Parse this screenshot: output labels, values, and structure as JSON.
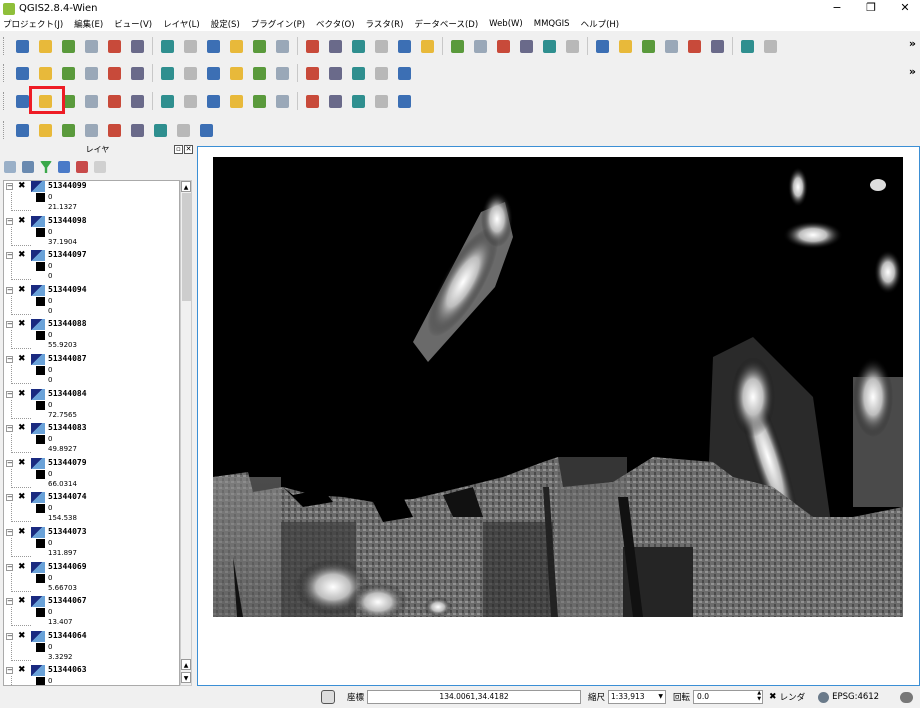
{
  "window": {
    "title": "QGIS2.8.4-Wien",
    "controls": [
      "−",
      "❐",
      "✕"
    ]
  },
  "menu": [
    "プロジェクト(J)",
    "編集(E)",
    "ビュー(V)",
    "レイヤ(L)",
    "設定(S)",
    "プラグイン(P)",
    "ベクタ(O)",
    "ラスタ(R)",
    "データベース(D)",
    "Web(W)",
    "MMQGIS",
    "ヘルプ(H)"
  ],
  "toolbars": {
    "overflow_label": "»",
    "file_tools": [
      "new-project",
      "open-project",
      "save-project",
      "save-as",
      "new-print-composer",
      "composer-manager",
      "pan-selected",
      "pan-map",
      "touch-zoom",
      "zoom-in",
      "zoom-out",
      "zoom-actual",
      "zoom-full",
      "zoom-to-selection",
      "zoom-to-layer",
      "zoom-last",
      "zoom-next",
      "refresh",
      "identify",
      "measure-identify",
      "select-features",
      "deselect",
      "field-calculator",
      "open-table",
      "statistics",
      "measure",
      "annotation",
      "text-annotation",
      "form-annotation",
      "label-tool",
      "pin-labels",
      "move-label"
    ],
    "edit_tools": [
      "current-edits",
      "toggle-editing",
      "save-edits",
      "add-feature",
      "move-feature",
      "node-tool",
      "delete-selected",
      "cut-features",
      "copy-features",
      "paste-features",
      "add-delimited-text",
      "add-wms",
      "georeferencer",
      "gps",
      "spatialite",
      "db-manager",
      "label-styles"
    ],
    "layer_tools": [
      "add-vector-layer",
      "add-raster-layer",
      "add-postgis",
      "add-spatialite",
      "add-mssql",
      "add-oracle",
      "add-wms-layer",
      "add-wcs",
      "add-wfs",
      "add-delimited",
      "new-shapefile",
      "new-spatialite",
      "python-console",
      "browser",
      "help",
      "whats-this",
      "advanced-digitize"
    ],
    "plugin_tools": [
      "raster-calculator",
      "processing",
      "clip-raster",
      "merge-raster",
      "warp",
      "translate",
      "contour",
      "polygonize",
      "raster-info"
    ],
    "highlighted_tool": "add-raster-layer"
  },
  "layers_panel": {
    "title": "レイヤ",
    "layers": [
      {
        "name": "51344099",
        "min": "0",
        "max": "21.1327"
      },
      {
        "name": "51344098",
        "min": "0",
        "max": "37.1904"
      },
      {
        "name": "51344097",
        "min": "0",
        "max": "0"
      },
      {
        "name": "51344094",
        "min": "0",
        "max": "0"
      },
      {
        "name": "51344088",
        "min": "0",
        "max": "55.9203"
      },
      {
        "name": "51344087",
        "min": "0",
        "max": "0"
      },
      {
        "name": "51344084",
        "min": "0",
        "max": "72.7565"
      },
      {
        "name": "51344083",
        "min": "0",
        "max": "49.8927"
      },
      {
        "name": "51344079",
        "min": "0",
        "max": "66.0314"
      },
      {
        "name": "51344074",
        "min": "0",
        "max": "154.538"
      },
      {
        "name": "51344073",
        "min": "0",
        "max": "131.897"
      },
      {
        "name": "51344069",
        "min": "0",
        "max": "5.66703"
      },
      {
        "name": "51344067",
        "min": "0",
        "max": "13.407"
      },
      {
        "name": "51344064",
        "min": "0",
        "max": "3.3292"
      },
      {
        "name": "51344063",
        "min": "0",
        "max": ""
      }
    ]
  },
  "statusbar": {
    "coord_label": "座標",
    "coord_value": "134.0061,34.4182",
    "scale_label": "縮尺",
    "scale_value": "1:33,913",
    "rotation_label": "回転",
    "rotation_value": "0.0",
    "render_label": "レンダ",
    "crs": "EPSG:4612"
  }
}
